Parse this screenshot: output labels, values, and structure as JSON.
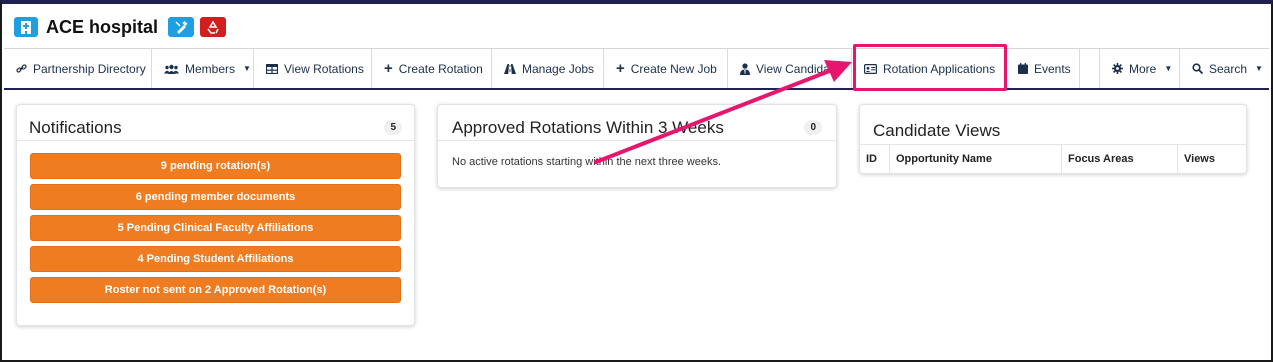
{
  "header": {
    "title": "ACE hospital",
    "hospital_icon": "hospital-icon",
    "edit_icon": "pencil-ruler-icon",
    "recycle_icon": "recycle-icon"
  },
  "nav": {
    "partnership_directory": "Partnership Directory",
    "members": "Members",
    "view_rotations": "View Rotations",
    "create_rotation": "Create Rotation",
    "manage_jobs": "Manage Jobs",
    "create_new_job": "Create New Job",
    "view_candidates": "View Candidate",
    "rotation_applications": "Rotation Applications",
    "events": "Events",
    "more": "More",
    "search": "Search"
  },
  "notifications": {
    "title": "Notifications",
    "count": "5",
    "items": [
      "9 pending rotation(s)",
      "6 pending member documents",
      "5 Pending Clinical Faculty Affiliations",
      "4 Pending Student Affiliations",
      "Roster not sent on 2 Approved Rotation(s)"
    ]
  },
  "approved": {
    "title": "Approved Rotations Within 3 Weeks",
    "count": "0",
    "message": "No active rotations starting within the next three weeks."
  },
  "candidate_views": {
    "title": "Candidate Views",
    "columns": [
      "ID",
      "Opportunity Name",
      "Focus Areas",
      "Views"
    ]
  },
  "colors": {
    "accent_orange": "#f07c22",
    "highlight_pink": "#e6166f",
    "nav_navy": "#1f2154",
    "tag_blue": "#1ea0e0",
    "tag_red": "#d11f1f"
  }
}
